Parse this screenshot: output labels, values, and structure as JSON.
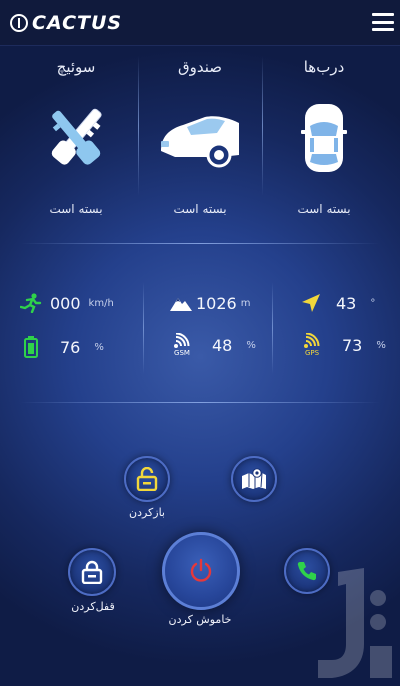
{
  "app": {
    "logo_text": "CACTUS"
  },
  "status": {
    "switch": {
      "title": "سوئیچ",
      "state": "بسته است",
      "icon": "key-icon"
    },
    "trunk": {
      "title": "صندوق",
      "state": "بسته است",
      "icon": "car-trunk-icon"
    },
    "doors": {
      "title": "درب‌ها",
      "state": "بسته است",
      "icon": "car-top-icon"
    }
  },
  "sensors": {
    "speed": {
      "value": "000",
      "unit": "km/h",
      "icon": "running-man-icon"
    },
    "altitude": {
      "value": "1026",
      "unit": "m",
      "icon": "mountain-icon"
    },
    "heading": {
      "value": "43",
      "unit": "°",
      "icon": "navigation-arrow-icon"
    },
    "battery": {
      "value": "76",
      "unit": "%",
      "icon": "battery-icon"
    },
    "gsm": {
      "value": "48",
      "unit": "%",
      "icon": "gsm-signal-icon",
      "icon_label": "GSM"
    },
    "gps": {
      "value": "73",
      "unit": "%",
      "icon": "gps-signal-icon",
      "icon_label": "GPS"
    }
  },
  "controls": {
    "unlock_label": "بازکردن",
    "lock_label": "قفل‌کردن",
    "power_label": "خاموش کردن",
    "map": "map-icon",
    "call": "phone-icon"
  },
  "colors": {
    "accent_green": "#2fd24a",
    "accent_yellow": "#f2d73b",
    "power_red": "#e5383b",
    "header": "#101a3c"
  }
}
